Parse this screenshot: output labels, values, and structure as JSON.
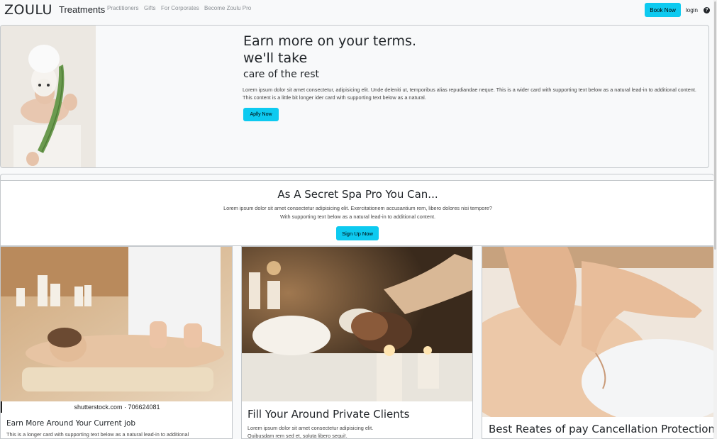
{
  "navbar": {
    "brand": "ZOULU",
    "treatments": "Treatments",
    "links": [
      "Practitioners",
      "Gifts",
      "For Corporates",
      "Become Zoulu Pro"
    ],
    "book_now": "Book Now",
    "login": "login",
    "help_icon": "?"
  },
  "hero": {
    "title_line1": "Earn more on your terms. we'll take",
    "title_line2": "care of the rest",
    "text": "Lorem ipsum dolor sit amet consectetur, adipisicing elit. Unde deleniti ut, temporibus alias repudiandae neque. This is a wider card with supporting text below as a natural lead-in to additional content. This content is a little bit longer ider card with supporting text below as a natural.",
    "apply_label": "Aplly Now"
  },
  "secret": {
    "title": "As A Secret Spa Pro You Can...",
    "line1": "Lorem ipsum dolor sit amet consectetur adipisicing elit. Exercitationem accusantium rem, libero dolores nisi tempore?",
    "line2": "With supporting text below as a natural lead-in to additional content.",
    "signup_label": "Sign Up Now"
  },
  "cards": [
    {
      "caption": "shutterstock.com · 706624081",
      "title": "Earn More Around Your Current job",
      "text": "This is a longer card with supporting text below as a natural lead-in to additional"
    },
    {
      "title": "Fill Your Around Private Clients",
      "text_line1": "Lorem ipsum dolor sit amet consectetur adipisicing elit.",
      "text_line2": "Quibusdam rem sed et, soluta libero sequi!."
    },
    {
      "title": "Best Reates of pay Cancellation Protection"
    }
  ],
  "colors": {
    "accent": "#0dcaf0",
    "background": "#f8f9fa",
    "border": "#c4c8cc"
  }
}
